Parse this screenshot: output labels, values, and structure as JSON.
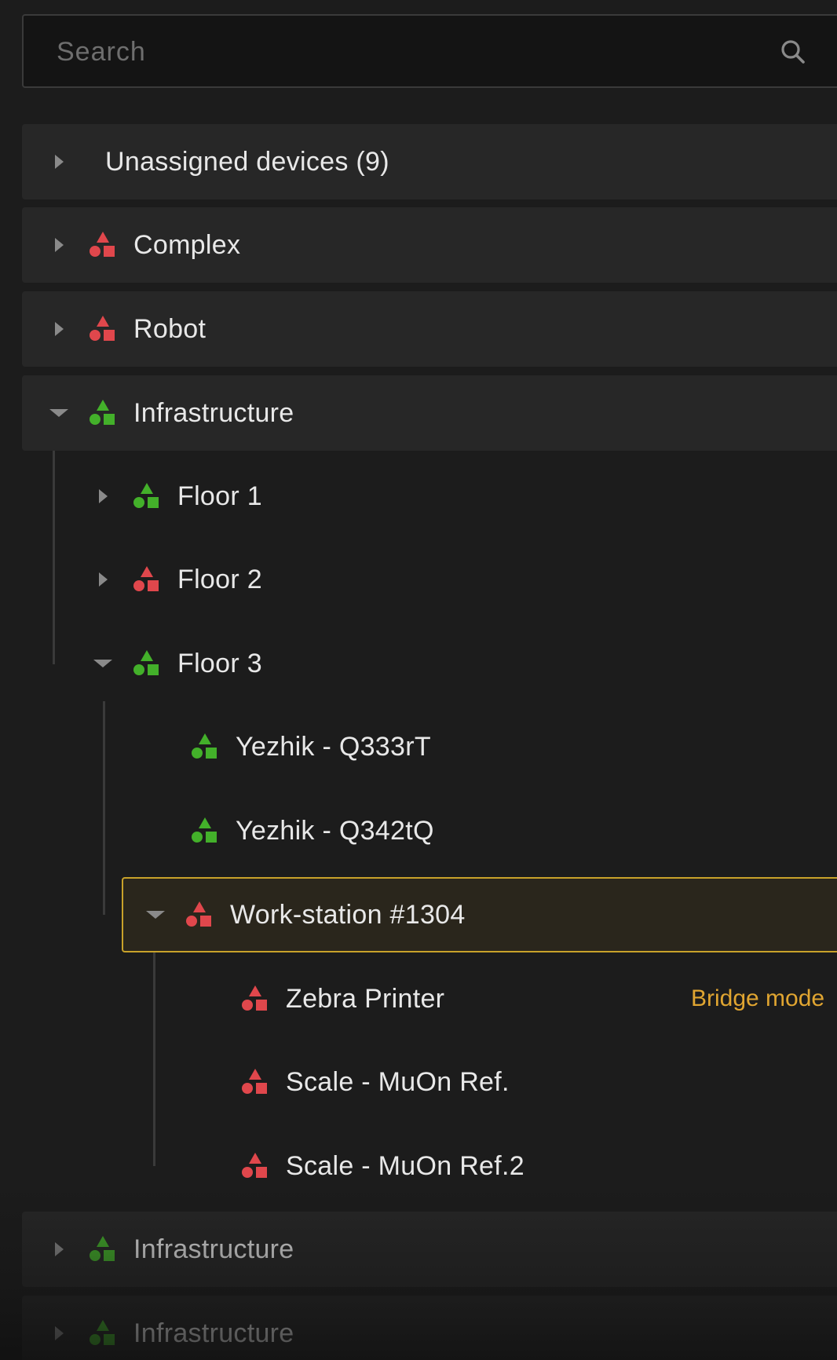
{
  "search": {
    "placeholder": "Search",
    "icon": "search-icon"
  },
  "colors": {
    "status_ok": "#43b02a",
    "status_alert": "#e0474c",
    "selection_border": "#c8a22a",
    "badge": "#e0a531"
  },
  "tree": {
    "unassigned": {
      "label": "Unassigned devices (9)"
    },
    "complex": {
      "label": "Complex",
      "status": "alert"
    },
    "robot": {
      "label": "Robot",
      "status": "alert"
    },
    "infrastructure": {
      "label": "Infrastructure",
      "status": "ok",
      "expanded": true
    },
    "floor1": {
      "label": "Floor 1",
      "status": "ok"
    },
    "floor2": {
      "label": "Floor 2",
      "status": "alert"
    },
    "floor3": {
      "label": "Floor 3",
      "status": "ok",
      "expanded": true
    },
    "yezhik1": {
      "label": "Yezhik - Q333rT",
      "status": "ok"
    },
    "yezhik2": {
      "label": "Yezhik - Q342tQ",
      "status": "ok"
    },
    "workstation": {
      "label": "Work-station #1304",
      "status": "alert",
      "expanded": true,
      "selected": true
    },
    "zebra": {
      "label": "Zebra Printer",
      "status": "alert",
      "badge": "Bridge mode"
    },
    "scale1": {
      "label": "Scale - MuOn Ref.",
      "status": "alert"
    },
    "scale2": {
      "label": "Scale - MuOn Ref.2",
      "status": "alert"
    },
    "infrastructure2": {
      "label": "Infrastructure",
      "status": "ok"
    },
    "infrastructure3": {
      "label": "Infrastructure",
      "status": "ok"
    }
  }
}
